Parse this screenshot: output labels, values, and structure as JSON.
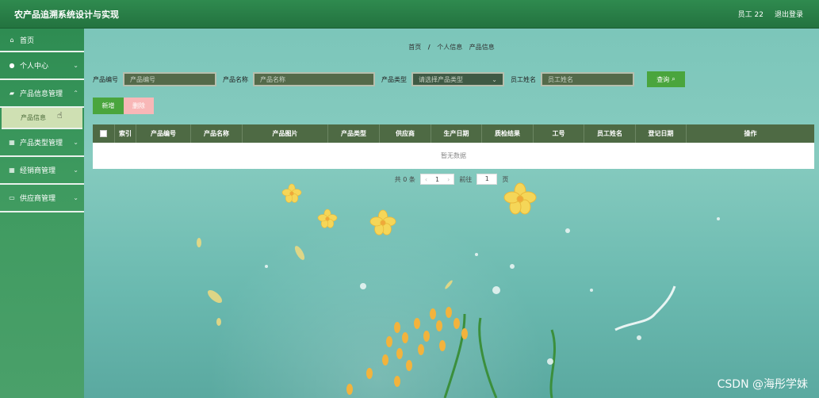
{
  "header": {
    "title": "农产品追溯系统设计与实现",
    "user": "员工 22",
    "logout": "退出登录"
  },
  "sidebar": {
    "items": [
      {
        "label": "首页",
        "icon": "home-icon"
      },
      {
        "label": "个人中心",
        "icon": "user-icon"
      },
      {
        "label": "产品信息管理",
        "icon": "folder-icon"
      },
      {
        "label": "产品类型管理",
        "icon": "grid-icon"
      },
      {
        "label": "经销商管理",
        "icon": "grid-icon"
      },
      {
        "label": "供应商管理",
        "icon": "monitor-icon"
      }
    ],
    "submenu": {
      "label": "产品信息"
    }
  },
  "breadcrumb": {
    "home": "首页",
    "sep": "/",
    "parent": "个人信息",
    "current": "产品信息"
  },
  "search": {
    "code_label": "产品编号",
    "code_placeholder": "产品编号",
    "name_label": "产品名称",
    "name_placeholder": "产品名称",
    "type_label": "产品类型",
    "type_placeholder": "请选择产品类型",
    "staff_label": "员工姓名",
    "staff_placeholder": "员工姓名",
    "query_label": "查询"
  },
  "actions": {
    "add_label": "新增",
    "delete_label": "删除"
  },
  "table": {
    "columns": [
      "索引",
      "产品编号",
      "产品名称",
      "产品图片",
      "产品类型",
      "供应商",
      "生产日期",
      "质检结果",
      "工号",
      "员工姓名",
      "登记日期",
      "操作"
    ],
    "empty_text": "暂无数据"
  },
  "pager": {
    "total": "共 0 条",
    "current_page": "1",
    "goto_label": "前往",
    "goto_value": "1",
    "page_unit": "页"
  },
  "watermark": "CSDN @海彤学妹",
  "colors": {
    "header": "#2f8a4f",
    "table_header": "#4e6a44",
    "primary_button": "#4aa53d",
    "danger_button": "#f8b7b7"
  }
}
